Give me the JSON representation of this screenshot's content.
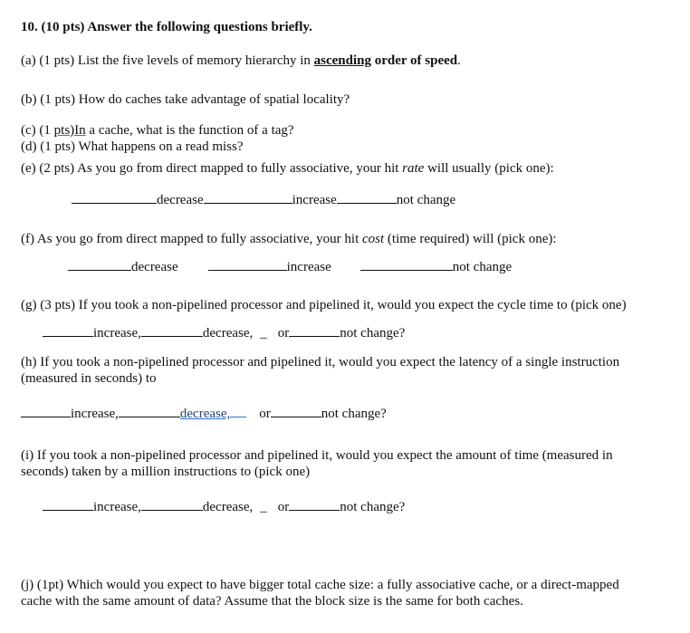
{
  "title": {
    "number": "10.",
    "points": "(10 pts)",
    "text": "Answer the following questions briefly."
  },
  "questions": {
    "a": {
      "prefix": "(a) (1 pts) List the five levels of memory hierarchy in ",
      "emphasis": "ascending",
      "bold_tail": " order of speed",
      "end": "."
    },
    "b": {
      "text": "(b) (1 pts) How do caches take advantage of spatial locality?"
    },
    "c": {
      "prefix": "(c) (1 ",
      "flagged": "pts)In",
      "rest": " a cache, what is the function of a tag?"
    },
    "d": {
      "text": "(d) (1 pts) What happens on a read miss?"
    },
    "e": {
      "prefix": "(e) (2 pts) As you go from direct mapped to fully associative, your hit ",
      "italic": "rate",
      "suffix": " will usually (pick one):",
      "options": [
        "decrease",
        "increase",
        "not change"
      ]
    },
    "f": {
      "prefix": "(f) As you go from direct mapped to fully associative, your hit ",
      "italic": "cost",
      "suffix": " (time required) will (pick one):",
      "options": [
        "decrease",
        "increase",
        "not change"
      ]
    },
    "g": {
      "text": "(g) (3 pts) If you took a non-pipelined processor and pipelined it, would you expect the cycle time to (pick one)",
      "options": [
        "increase,",
        "decrease,",
        "or",
        "not change?"
      ]
    },
    "h": {
      "line1": "(h) If you took a non-pipelined processor and pipelined it, would you expect the latency of a single instruction",
      "line2": "(measured in seconds) to",
      "options": [
        "increase,",
        "decrease,",
        "or",
        "not change?"
      ]
    },
    "i": {
      "line1": "(i) If you took a non-pipelined processor and pipelined it, would you expect the amount of time (measured in",
      "line2": "seconds) taken by a million instructions to (pick one)",
      "options": [
        "increase,",
        "decrease,",
        "or",
        "not change?"
      ]
    },
    "j": {
      "line1": "(j) (1pt) Which would you expect to have bigger total cache size: a fully associative cache, or a direct-mapped",
      "line2": "cache with the same amount of data? Assume that the block size is the same for both caches."
    }
  },
  "underscore": "_"
}
